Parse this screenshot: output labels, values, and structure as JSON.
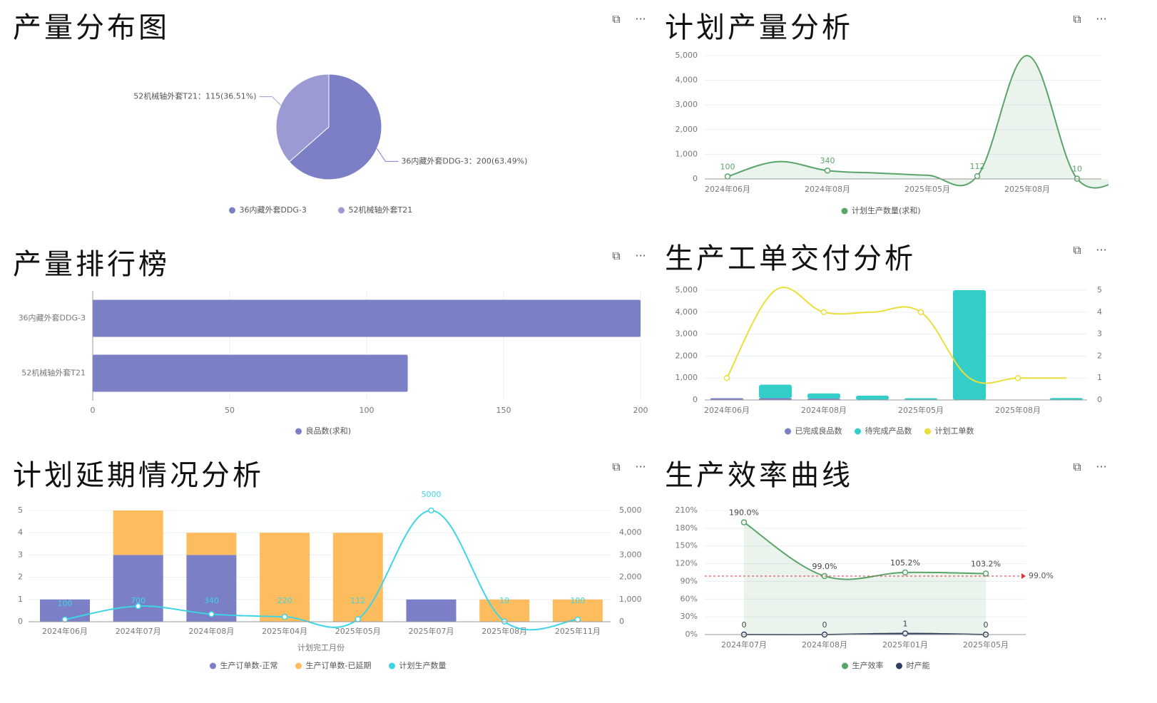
{
  "panels": {
    "p1": {
      "title": "产量分布图"
    },
    "p2": {
      "title": "计划产量分析"
    },
    "p3": {
      "title": "产量排行榜"
    },
    "p4": {
      "title": "生产工单交付分析"
    },
    "p5": {
      "title": "计划延期情况分析"
    },
    "p6": {
      "title": "生产效率曲线"
    }
  },
  "toolbar": {
    "expand_icon": "⧉",
    "more_icon": "···"
  },
  "colors": {
    "purple": "#7b7fc6",
    "purple_light": "#9b9ad3",
    "orange": "#fdbd5f",
    "cyan": "#3dd5e6",
    "teal": "#33cec7",
    "green": "#5aa46a",
    "yellow": "#eadf3a",
    "navy": "#2f3f5f",
    "red": "#d9363e"
  },
  "chart_data": [
    {
      "id": "pie",
      "type": "pie",
      "slices": [
        {
          "name": "36内藏外套DDG-3",
          "value": 200,
          "percent": 63.49,
          "label": "36内藏外套DDG-3：200(63.49%)"
        },
        {
          "name": "52机械轴外套T21",
          "value": 115,
          "percent": 36.51,
          "label": "52机械轴外套T21：115(36.51%)"
        }
      ],
      "legend": [
        "36内藏外套DDG-3",
        "52机械轴外套T21"
      ]
    },
    {
      "id": "plan",
      "type": "area",
      "series": [
        {
          "name": "计划生产数量(求和)",
          "values": [
            100,
            700,
            340,
            240,
            150,
            112,
            5000,
            10,
            100
          ]
        }
      ],
      "point_labels": [
        {
          "index": 0,
          "text": "100"
        },
        {
          "index": 2,
          "text": "340"
        },
        {
          "index": 5,
          "text": "112"
        },
        {
          "index": 7,
          "text": "10"
        }
      ],
      "xticks": [
        "2024年06月",
        "2024年08月",
        "2025年05月",
        "2025年08月"
      ],
      "ylim": [
        0,
        5000
      ],
      "yticks": [
        "0",
        "1,000",
        "2,000",
        "3,000",
        "4,000",
        "5,000"
      ],
      "legend": [
        "计划生产数量(求和)"
      ]
    },
    {
      "id": "rank",
      "type": "bar",
      "orientation": "horizontal",
      "categories": [
        "36内藏外套DDG-3",
        "52机械轴外套T21"
      ],
      "values": [
        200,
        115
      ],
      "xlim": [
        0,
        200
      ],
      "xticks": [
        "0",
        "50",
        "100",
        "150",
        "200"
      ],
      "legend": [
        "良品数(求和)"
      ]
    },
    {
      "id": "delivery",
      "type": "bar",
      "series": [
        {
          "name": "已完成良品数",
          "values": [
            80,
            80,
            60,
            0,
            0,
            0,
            0,
            0
          ]
        },
        {
          "name": "待完成产品数",
          "values": [
            0,
            620,
            240,
            200,
            80,
            5000,
            10,
            90
          ]
        },
        {
          "name": "计划工单数",
          "values": [
            1,
            5,
            4,
            4,
            4,
            1,
            1,
            1
          ]
        }
      ],
      "xticks": [
        "2024年06月",
        "2024年08月",
        "2025年05月",
        "2025年08月"
      ],
      "ylim_left": [
        0,
        5000
      ],
      "ylim_right": [
        0,
        5
      ],
      "yticks_left": [
        "0",
        "1,000",
        "2,000",
        "3,000",
        "4,000",
        "5,000"
      ],
      "yticks_right": [
        "0",
        "1",
        "2",
        "3",
        "4",
        "5"
      ],
      "legend": [
        "已完成良品数",
        "待完成产品数",
        "计划工单数"
      ]
    },
    {
      "id": "delay",
      "type": "bar",
      "categories": [
        "2024年06月",
        "2024年07月",
        "2024年08月",
        "2025年04月",
        "2025年05月",
        "2025年07月",
        "2025年08月",
        "2025年11月"
      ],
      "series": [
        {
          "name": "生产订单数-正常",
          "values": [
            1,
            3,
            3,
            0,
            0,
            1,
            0,
            0
          ]
        },
        {
          "name": "生产订单数-已延期",
          "values": [
            0,
            2,
            1,
            4,
            4,
            0,
            1,
            1
          ]
        },
        {
          "name": "计划生产数量",
          "values": [
            100,
            700,
            340,
            220,
            112,
            5000,
            10,
            100
          ]
        }
      ],
      "line_labels": [
        "100",
        "700",
        "340",
        "220",
        "112",
        "5000",
        "10",
        "100"
      ],
      "xlabel": "计划完工月份",
      "ylim_left": [
        0,
        5
      ],
      "ylim_right": [
        0,
        5000
      ],
      "yticks_left": [
        "0",
        "1",
        "2",
        "3",
        "4",
        "5"
      ],
      "yticks_right": [
        "0",
        "1,000",
        "2,000",
        "3,000",
        "4,000",
        "5,000"
      ],
      "legend": [
        "生产订单数-正常",
        "生产订单数-已延期",
        "计划生产数量"
      ]
    },
    {
      "id": "efficiency",
      "type": "line",
      "categories": [
        "2024年07月",
        "2024年08月",
        "2025年01月",
        "2025年05月"
      ],
      "series": [
        {
          "name": "生产效率",
          "values": [
            190.0,
            99.0,
            105.2,
            103.2
          ],
          "labels": [
            "190.0%",
            "99.0%",
            "105.2%",
            "103.2%"
          ]
        },
        {
          "name": "时产能",
          "values": [
            0,
            0,
            1,
            0
          ],
          "labels": [
            "0",
            "0",
            "1",
            "0"
          ]
        }
      ],
      "reference_line": {
        "value": 99.0,
        "label": "99.0%"
      },
      "ylim": [
        0,
        210
      ],
      "yticks": [
        "0%",
        "30%",
        "60%",
        "90%",
        "120%",
        "150%",
        "180%",
        "210%"
      ],
      "legend": [
        "生产效率",
        "时产能"
      ]
    }
  ]
}
